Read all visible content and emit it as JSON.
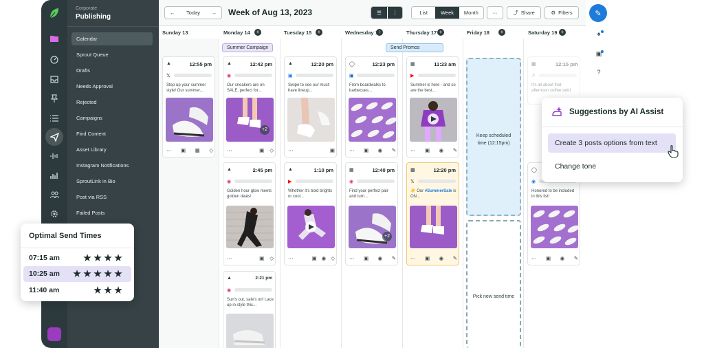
{
  "sidebar": {
    "org_label": "Corporate",
    "section_title": "Publishing",
    "items": [
      {
        "label": "Calendar"
      },
      {
        "label": "Sprout Queue"
      },
      {
        "label": "Drafts"
      },
      {
        "label": "Needs Approval"
      },
      {
        "label": "Rejected"
      },
      {
        "label": "Campaigns"
      },
      {
        "label": "Find Content"
      },
      {
        "label": "Asset Library"
      },
      {
        "label": "Instagram Notifications"
      },
      {
        "label": "SproutLink in Bio"
      },
      {
        "label": "Post via RSS"
      },
      {
        "label": "Failed Posts"
      }
    ]
  },
  "toolbar": {
    "prev_icon": "arrow-left-icon",
    "today_label": "Today",
    "next_icon": "arrow-right-icon",
    "week_title": "Week of Aug 13, 2023",
    "view_list": "List",
    "view_week": "Week",
    "view_month": "Month",
    "more_label": "···",
    "share_label": "Share",
    "filters_label": "Filters"
  },
  "days": [
    {
      "label": "Sunday 13"
    },
    {
      "label": "Monday 14"
    },
    {
      "label": "Tuesday 15"
    },
    {
      "label": "Wednesday 16"
    },
    {
      "label": "Thursday 17"
    },
    {
      "label": "Friday 18"
    },
    {
      "label": "Saturday 19"
    }
  ],
  "campaigns": {
    "summer": "Summer Campaign",
    "promos": "Send Promos"
  },
  "posts": {
    "sun1": {
      "time": "12:55 pm",
      "network": "X",
      "text": "Step up your summer style! Our summer..."
    },
    "mon1": {
      "time": "12:42 pm",
      "network": "Instagram",
      "text": "Our sneakers are on SALE, perfect for...",
      "more": "+2"
    },
    "mon2": {
      "time": "2:45 pm",
      "network": "Instagram",
      "text": "Golden hour glow meets golden deals!"
    },
    "mon3": {
      "time": "2:21 pm",
      "network": "Instagram",
      "text": "Sun's out, sale's on! Lace up in style this..."
    },
    "tue1": {
      "time": "12:20 pm",
      "network": "Facebook",
      "text": "Swipe to see our must-have lineup..."
    },
    "tue2": {
      "time": "1:10 pm",
      "network": "YouTube",
      "text": "Whether it's bold brights or cool..."
    },
    "wed1": {
      "time": "12:23 pm",
      "network": "LinkedIn",
      "text": "From boardwalks to barbecues..."
    },
    "wed2": {
      "time": "12:40 pm",
      "network": "Instagram",
      "text": "Find your perfect pair and turn...",
      "more": "+2"
    },
    "thu1": {
      "time": "11:23 am",
      "network": "YouTube",
      "text": "Summer is here - and so are the best..."
    },
    "thu2": {
      "time": "12:20 pm",
      "network": "X",
      "text_prefix": "Our ",
      "hashtag": "#SummerSale",
      "text_suffix": " is ON..."
    },
    "sat1": {
      "time": "12:15 pm",
      "network": "TikTok",
      "text": "It's all about that afternoon coffee swirl"
    },
    "sat2": {
      "network": "Facebook",
      "text": "Honored to be included in this list!"
    }
  },
  "friday": {
    "keep_text": "Keep scheduled time (12:15pm)",
    "pick_text": "Pick new send time"
  },
  "ai_panel": {
    "title": "Suggestions by AI Assist",
    "options": [
      {
        "label": "Create 3 posts options from text"
      },
      {
        "label": "Change tone"
      }
    ]
  },
  "send_times": {
    "title": "Optimal Send Times",
    "rows": [
      {
        "time": "07:15 am",
        "stars": 4
      },
      {
        "time": "10:25 am",
        "stars": 5
      },
      {
        "time": "11:40 am",
        "stars": 3
      }
    ]
  },
  "colors": {
    "accent_blue": "#1f7bd9",
    "brand_purple": "#9b3cc0",
    "sidebar_dark": "#364245",
    "rail_dark": "#2d3a3d",
    "campaign_purple": "#e9e4f6",
    "campaign_blue": "#d8ebfb",
    "highlight_yellow": "#fff7e2"
  }
}
